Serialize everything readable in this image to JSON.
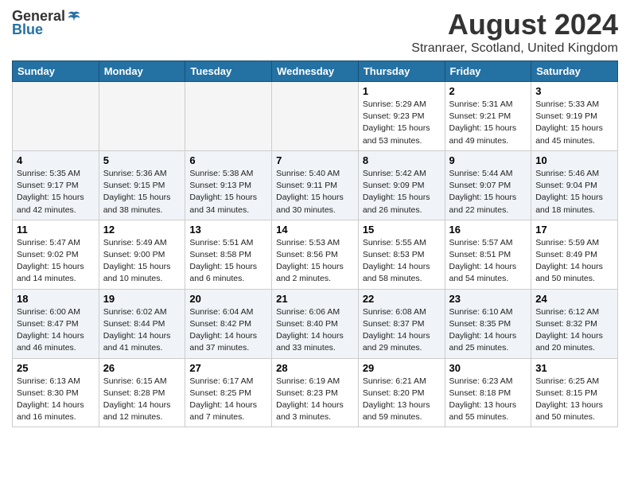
{
  "logo": {
    "general": "General",
    "blue": "Blue"
  },
  "title": {
    "month_year": "August 2024",
    "location": "Stranraer, Scotland, United Kingdom"
  },
  "days_of_week": [
    "Sunday",
    "Monday",
    "Tuesday",
    "Wednesday",
    "Thursday",
    "Friday",
    "Saturday"
  ],
  "weeks": [
    [
      {
        "day": "",
        "empty": true
      },
      {
        "day": "",
        "empty": true
      },
      {
        "day": "",
        "empty": true
      },
      {
        "day": "",
        "empty": true
      },
      {
        "day": "1",
        "empty": false,
        "info": "Sunrise: 5:29 AM\nSunset: 9:23 PM\nDaylight: 15 hours\nand 53 minutes."
      },
      {
        "day": "2",
        "empty": false,
        "info": "Sunrise: 5:31 AM\nSunset: 9:21 PM\nDaylight: 15 hours\nand 49 minutes."
      },
      {
        "day": "3",
        "empty": false,
        "info": "Sunrise: 5:33 AM\nSunset: 9:19 PM\nDaylight: 15 hours\nand 45 minutes."
      }
    ],
    [
      {
        "day": "4",
        "empty": false,
        "info": "Sunrise: 5:35 AM\nSunset: 9:17 PM\nDaylight: 15 hours\nand 42 minutes."
      },
      {
        "day": "5",
        "empty": false,
        "info": "Sunrise: 5:36 AM\nSunset: 9:15 PM\nDaylight: 15 hours\nand 38 minutes."
      },
      {
        "day": "6",
        "empty": false,
        "info": "Sunrise: 5:38 AM\nSunset: 9:13 PM\nDaylight: 15 hours\nand 34 minutes."
      },
      {
        "day": "7",
        "empty": false,
        "info": "Sunrise: 5:40 AM\nSunset: 9:11 PM\nDaylight: 15 hours\nand 30 minutes."
      },
      {
        "day": "8",
        "empty": false,
        "info": "Sunrise: 5:42 AM\nSunset: 9:09 PM\nDaylight: 15 hours\nand 26 minutes."
      },
      {
        "day": "9",
        "empty": false,
        "info": "Sunrise: 5:44 AM\nSunset: 9:07 PM\nDaylight: 15 hours\nand 22 minutes."
      },
      {
        "day": "10",
        "empty": false,
        "info": "Sunrise: 5:46 AM\nSunset: 9:04 PM\nDaylight: 15 hours\nand 18 minutes."
      }
    ],
    [
      {
        "day": "11",
        "empty": false,
        "info": "Sunrise: 5:47 AM\nSunset: 9:02 PM\nDaylight: 15 hours\nand 14 minutes."
      },
      {
        "day": "12",
        "empty": false,
        "info": "Sunrise: 5:49 AM\nSunset: 9:00 PM\nDaylight: 15 hours\nand 10 minutes."
      },
      {
        "day": "13",
        "empty": false,
        "info": "Sunrise: 5:51 AM\nSunset: 8:58 PM\nDaylight: 15 hours\nand 6 minutes."
      },
      {
        "day": "14",
        "empty": false,
        "info": "Sunrise: 5:53 AM\nSunset: 8:56 PM\nDaylight: 15 hours\nand 2 minutes."
      },
      {
        "day": "15",
        "empty": false,
        "info": "Sunrise: 5:55 AM\nSunset: 8:53 PM\nDaylight: 14 hours\nand 58 minutes."
      },
      {
        "day": "16",
        "empty": false,
        "info": "Sunrise: 5:57 AM\nSunset: 8:51 PM\nDaylight: 14 hours\nand 54 minutes."
      },
      {
        "day": "17",
        "empty": false,
        "info": "Sunrise: 5:59 AM\nSunset: 8:49 PM\nDaylight: 14 hours\nand 50 minutes."
      }
    ],
    [
      {
        "day": "18",
        "empty": false,
        "info": "Sunrise: 6:00 AM\nSunset: 8:47 PM\nDaylight: 14 hours\nand 46 minutes."
      },
      {
        "day": "19",
        "empty": false,
        "info": "Sunrise: 6:02 AM\nSunset: 8:44 PM\nDaylight: 14 hours\nand 41 minutes."
      },
      {
        "day": "20",
        "empty": false,
        "info": "Sunrise: 6:04 AM\nSunset: 8:42 PM\nDaylight: 14 hours\nand 37 minutes."
      },
      {
        "day": "21",
        "empty": false,
        "info": "Sunrise: 6:06 AM\nSunset: 8:40 PM\nDaylight: 14 hours\nand 33 minutes."
      },
      {
        "day": "22",
        "empty": false,
        "info": "Sunrise: 6:08 AM\nSunset: 8:37 PM\nDaylight: 14 hours\nand 29 minutes."
      },
      {
        "day": "23",
        "empty": false,
        "info": "Sunrise: 6:10 AM\nSunset: 8:35 PM\nDaylight: 14 hours\nand 25 minutes."
      },
      {
        "day": "24",
        "empty": false,
        "info": "Sunrise: 6:12 AM\nSunset: 8:32 PM\nDaylight: 14 hours\nand 20 minutes."
      }
    ],
    [
      {
        "day": "25",
        "empty": false,
        "info": "Sunrise: 6:13 AM\nSunset: 8:30 PM\nDaylight: 14 hours\nand 16 minutes."
      },
      {
        "day": "26",
        "empty": false,
        "info": "Sunrise: 6:15 AM\nSunset: 8:28 PM\nDaylight: 14 hours\nand 12 minutes."
      },
      {
        "day": "27",
        "empty": false,
        "info": "Sunrise: 6:17 AM\nSunset: 8:25 PM\nDaylight: 14 hours\nand 7 minutes."
      },
      {
        "day": "28",
        "empty": false,
        "info": "Sunrise: 6:19 AM\nSunset: 8:23 PM\nDaylight: 14 hours\nand 3 minutes."
      },
      {
        "day": "29",
        "empty": false,
        "info": "Sunrise: 6:21 AM\nSunset: 8:20 PM\nDaylight: 13 hours\nand 59 minutes."
      },
      {
        "day": "30",
        "empty": false,
        "info": "Sunrise: 6:23 AM\nSunset: 8:18 PM\nDaylight: 13 hours\nand 55 minutes."
      },
      {
        "day": "31",
        "empty": false,
        "info": "Sunrise: 6:25 AM\nSunset: 8:15 PM\nDaylight: 13 hours\nand 50 minutes."
      }
    ]
  ]
}
